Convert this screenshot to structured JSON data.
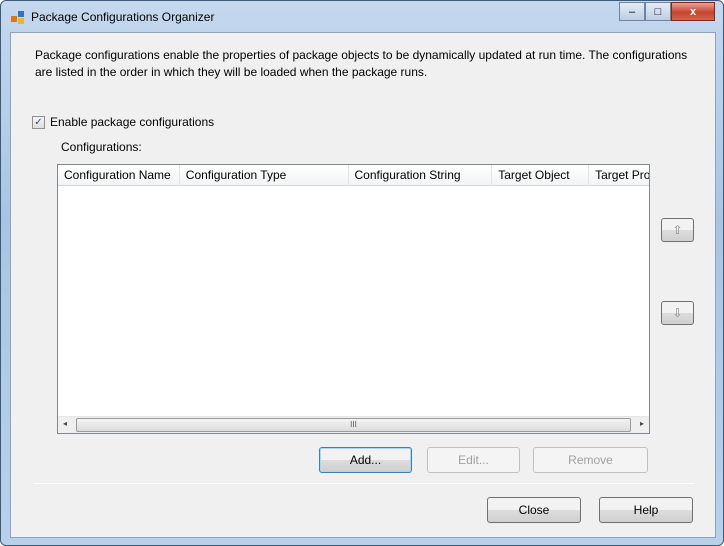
{
  "window": {
    "title": "Package Configurations Organizer",
    "controls": {
      "minimize": "–",
      "maximize": "□",
      "close": "x"
    }
  },
  "description": "Package configurations enable the properties of package objects to be dynamically updated at run time. The configurations are listed in the order in which they will be loaded when the package runs.",
  "enable_checkbox": {
    "label": "Enable package configurations",
    "checked": true,
    "mark": "✓"
  },
  "configurations_label": "Configurations:",
  "table": {
    "columns": [
      "Configuration Name",
      "Configuration Type",
      "Configuration String",
      "Target Object",
      "Target Pro"
    ],
    "rows": []
  },
  "scrollbar": {
    "left": "◂",
    "right": "▸",
    "grip": "III"
  },
  "move_up": "⇧",
  "move_down": "⇩",
  "buttons": {
    "add": "Add...",
    "edit": "Edit...",
    "remove": "Remove",
    "close": "Close",
    "help": "Help"
  }
}
